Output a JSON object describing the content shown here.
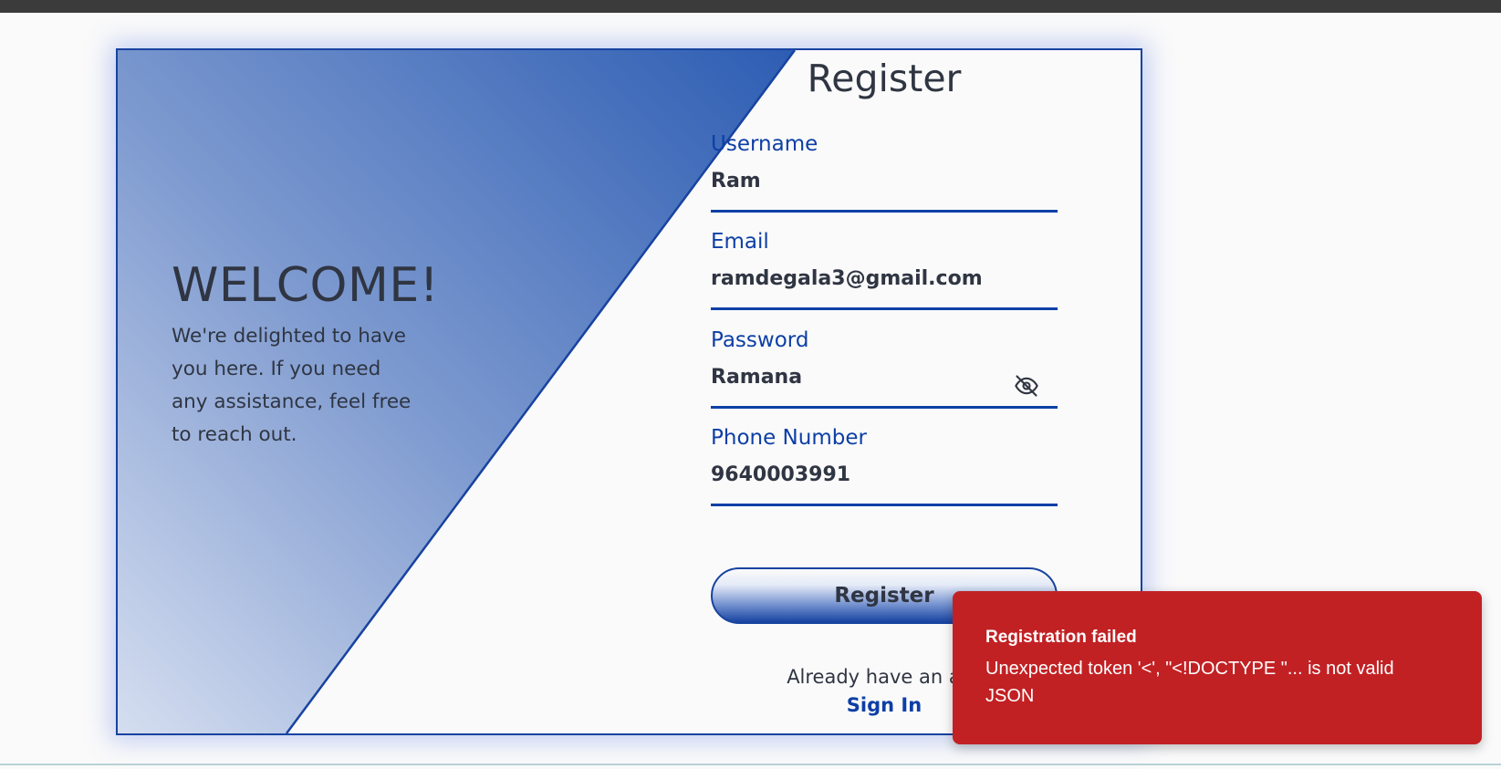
{
  "colors": {
    "primary": "#0d3fa6",
    "border": "#1843a0",
    "toast_background": "#c22124",
    "text": "#2f3542",
    "background": "#fafafa"
  },
  "welcome": {
    "title": "WELCOME!",
    "message": "We're delighted to have you here. If you need any assistance, feel free to reach out."
  },
  "form": {
    "title": "Register",
    "fields": [
      {
        "label": "Username",
        "value": "Ram"
      },
      {
        "label": "Email",
        "value": "ramdegala3@gmail.com"
      },
      {
        "label": "Password",
        "value": "Ramana",
        "icon": "eye-off-icon"
      },
      {
        "label": "Phone Number",
        "value": "9640003991"
      }
    ],
    "submit_label": "Register",
    "signin_prompt": "Already have an acc",
    "signin_link": "Sign In"
  },
  "toast": {
    "title": "Registration failed",
    "message": "Unexpected token '<', \"<!DOCTYPE \"... is not valid JSON"
  }
}
